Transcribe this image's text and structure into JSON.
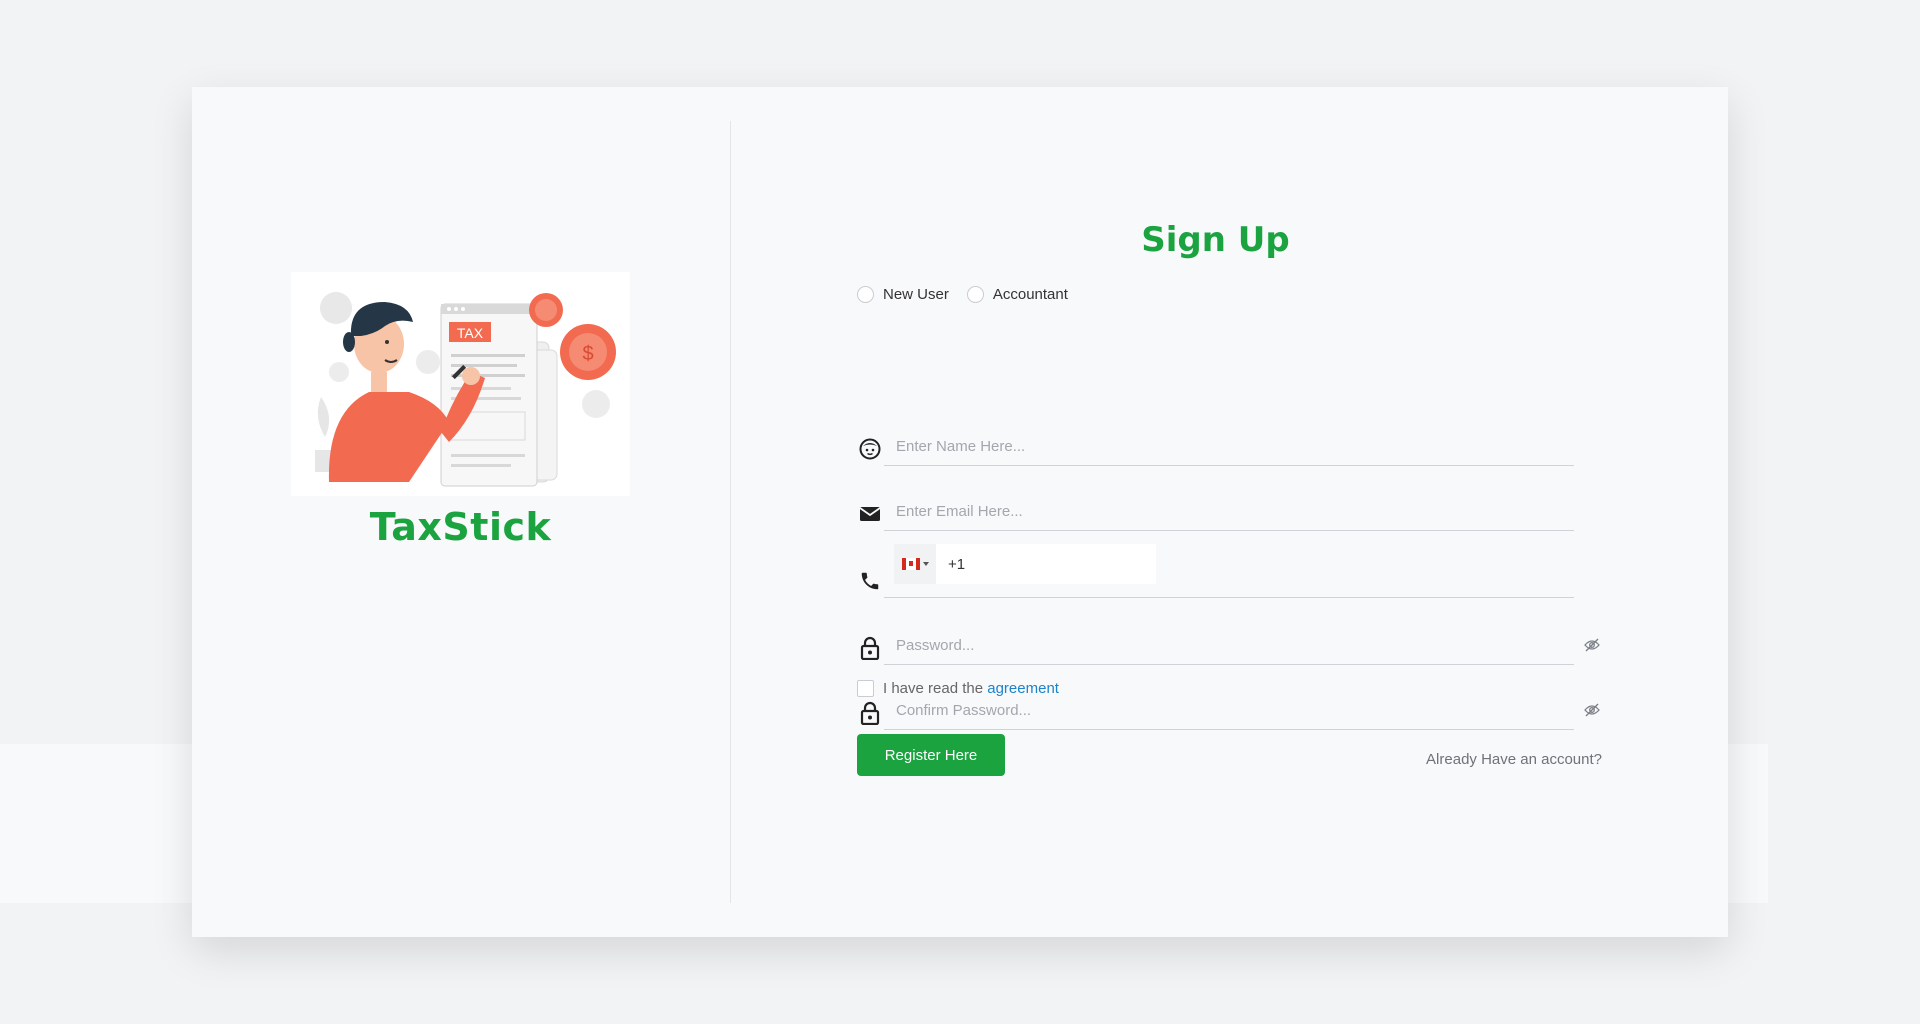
{
  "brand": {
    "name": "TaxStick",
    "illustration_text": "TAX"
  },
  "form": {
    "title": "Sign Up",
    "roles": [
      {
        "label": "New User",
        "selected": false
      },
      {
        "label": "Accountant",
        "selected": false
      }
    ],
    "name": {
      "placeholder": "Enter Name Here...",
      "icon": "face-icon"
    },
    "email": {
      "placeholder": "Enter Email Here...",
      "icon": "mail-icon"
    },
    "phone": {
      "country": "CA",
      "value": "+1",
      "icon": "phone-icon"
    },
    "password": {
      "placeholder": "Password...",
      "icon": "lock-icon"
    },
    "confirm_password": {
      "placeholder": "Confirm Password...",
      "icon": "lock-icon"
    },
    "agreement": {
      "text": "I have read the",
      "link": "agreement",
      "checked": false
    },
    "register_label": "Register Here",
    "login_link": "Already Have an account?"
  },
  "colors": {
    "brand_green": "#1aa33f",
    "link_blue": "#1d84c9",
    "illustration_orange": "#f26b50"
  }
}
